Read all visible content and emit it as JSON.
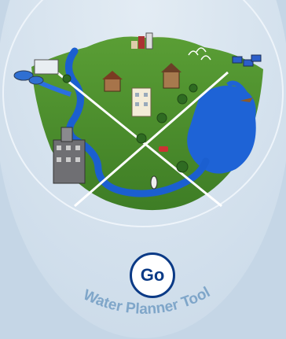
{
  "go_button": {
    "label": "Go"
  },
  "tool_title": "Water Planner Tool",
  "colors": {
    "background": "#c9d9e8",
    "inner_disc": "#d6e3ee",
    "land": "#4b8f2e",
    "water": "#1e63d6",
    "sky_glow": "#f0b84a",
    "accent": "#0b3a86",
    "arc_text": "#7fa6c9"
  }
}
